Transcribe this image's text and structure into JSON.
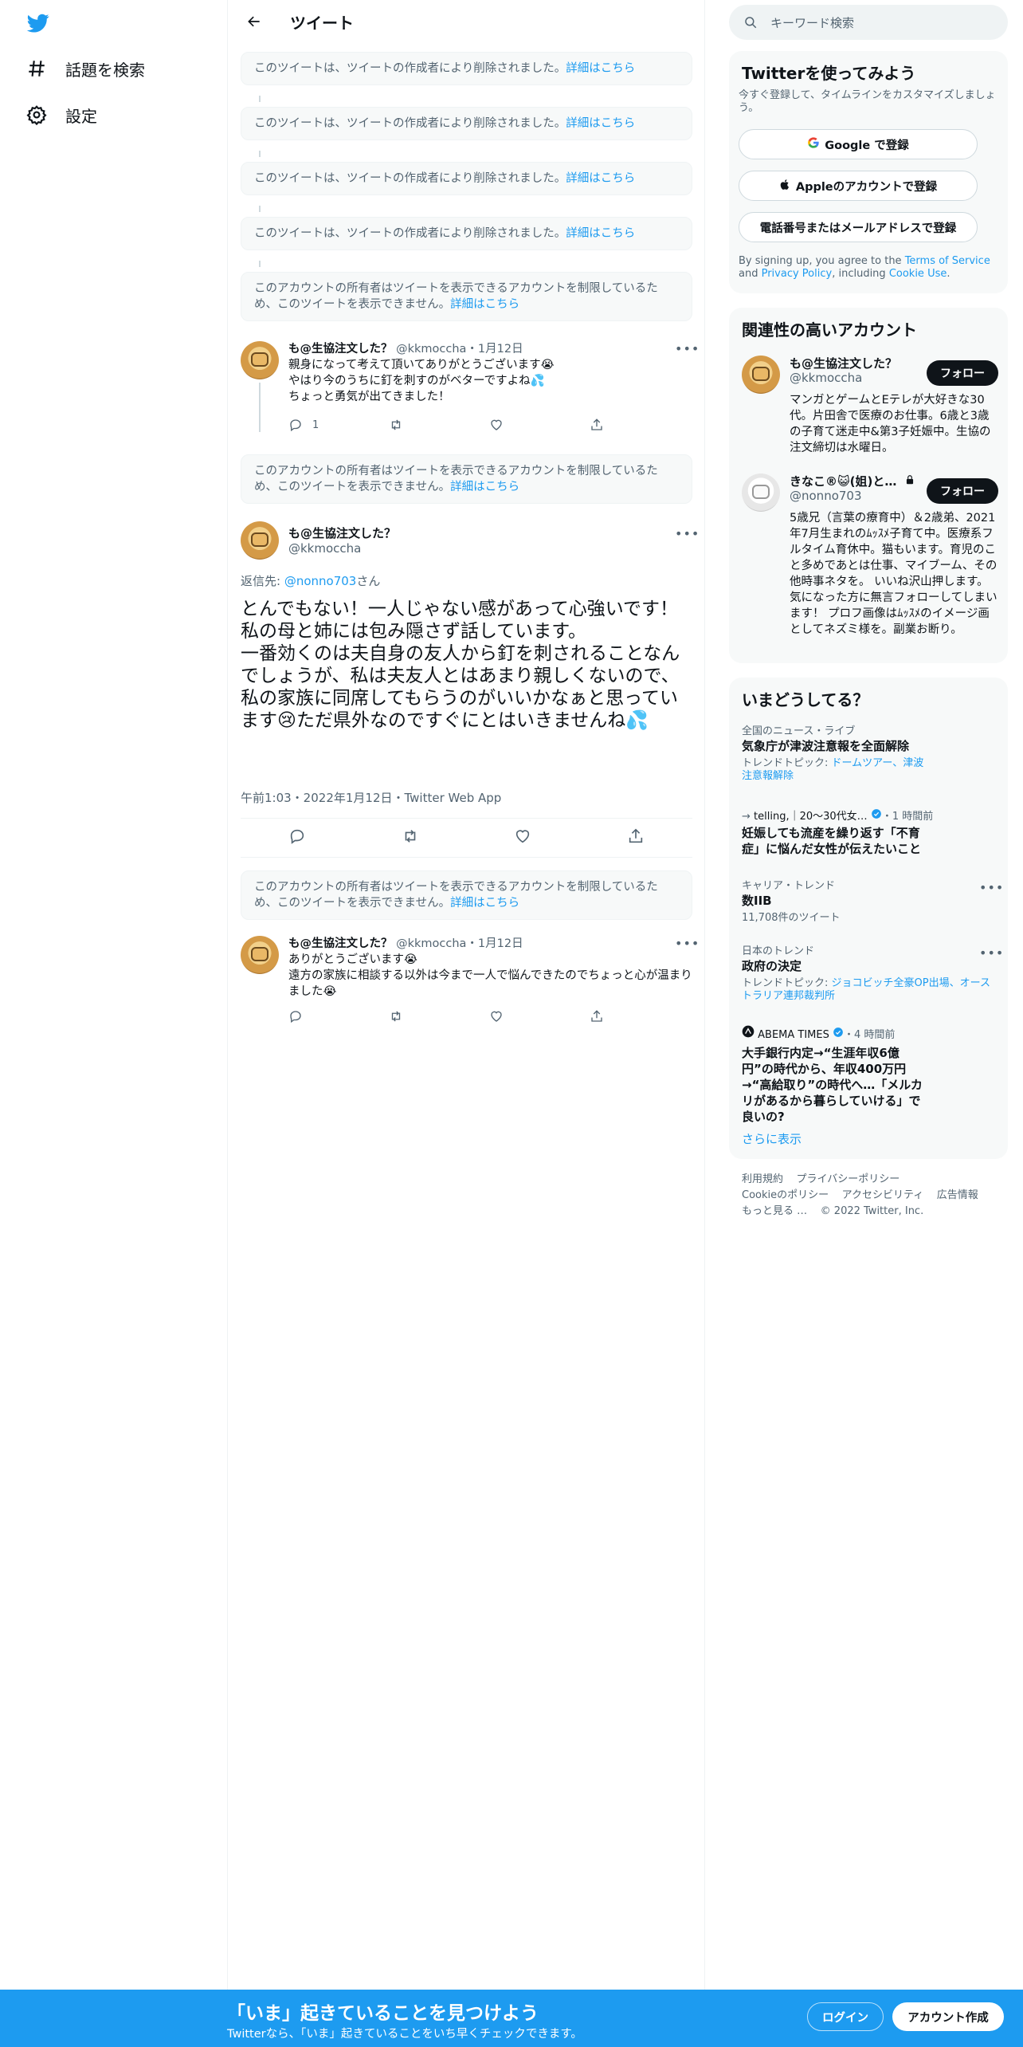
{
  "nav": {
    "explore": "話題を検索",
    "settings": "設定"
  },
  "header": {
    "title": "ツイート"
  },
  "notices": {
    "deleted": "このツイートは、ツイートの作成者により削除されました。",
    "restricted": "このアカウントの所有者はツイートを表示できるアカウントを制限しているため、このツイートを表示できません。",
    "link": "詳細はこちら"
  },
  "tweet1": {
    "name": "も@生協注文した？",
    "handle": "@kkmoccha",
    "date": "1月12日",
    "text": "親身になって考えて頂いてありがとうございます😭\nやはり今のうちに釘を刺すのがベターですよね💦\nちょっと勇気が出てきました！",
    "reply_count": "1"
  },
  "focus": {
    "name": "も@生協注文した？",
    "handle": "@kkmoccha",
    "reply_prefix": "返信先: ",
    "reply_to": "@nonno703",
    "reply_suffix": "さん",
    "text": "とんでもない！一人じゃない感があって心強いです！\n私の母と姉には包み隠さず話しています。\n一番効くのは夫自身の友人から釘を刺されることなんでしょうが、私は夫友人とはあまり親しくないので、私の家族に同席してもらうのがいいかなぁと思っています😢ただ県外なのですぐにとはいきませんね💦",
    "meta": "午前1:03・2022年1月12日・Twitter Web App"
  },
  "tweet2": {
    "name": "も@生協注文した？",
    "handle": "@kkmoccha",
    "date": "1月12日",
    "text": "ありがとうございます😭\n遠方の家族に相談する以外は今まで一人で悩んできたのでちょっと心が温まりました😭"
  },
  "right": {
    "search_placeholder": "キーワード検索",
    "signup": {
      "title": "Twitterを使ってみよう",
      "subtitle": "今すぐ登録して、タイムラインをカスタマイズしましょう。",
      "google": "Google で登録",
      "apple": "Appleのアカウントで登録",
      "phone": "電話番号またはメールアドレスで登録",
      "terms_pre": "By signing up, you agree to the ",
      "terms": "Terms of Service",
      "and": " and ",
      "privacy": "Privacy Policy",
      "including": ", including ",
      "cookie": "Cookie Use",
      "end": "."
    },
    "related": {
      "title": "関連性の高いアカウント",
      "follow": "フォロー",
      "accounts": [
        {
          "name": "も@生協注文した？",
          "handle": "@kkmoccha",
          "bio": "マンガとゲームとEテレが大好きな30代。片田舎で医療のお仕事。6歳と3歳の子育て迷走中&第3子妊娠中。生協の注文締切は水曜日。"
        },
        {
          "name": "きなこ®😺(姐)と…",
          "handle": "@nonno703",
          "bio": "5歳兄（言葉の療育中）＆2歳弟、2021年7月生まれのﾑｯｽﾒ子育て中。医療系フルタイム育休中。猫もいます。育児のこと多めであとは仕事、マイブーム、その他時事ネタを。 いいね沢山押します。気になった方に無言フォローしてしまいます！ プロフ画像はﾑｯｽﾒのイメージ画としてネズミ様を。副業お断り。"
        }
      ]
    },
    "trends": {
      "title": "いまどうしてる？",
      "items": [
        {
          "context": "全国のニュース・ライブ",
          "title": "気象庁が津波注意報を全面解除",
          "topic_label": "トレンドトピック: ",
          "topic": "ドームツアー、津波注意報解除"
        },
        {
          "source": "telling,｜20～30代女…",
          "time": "・1 時間前",
          "title": "妊娠しても流産を繰り返す「不育症」に悩んだ女性が伝えたいこと"
        },
        {
          "context": "キャリア・トレンド",
          "title": "数IIB",
          "count": "11,708件のツイート"
        },
        {
          "context": "日本のトレンド",
          "title": "政府の決定",
          "topic_label": "トレンドトピック: ",
          "topic": "ジョコビッチ全豪OP出場、オーストラリア連邦裁判所"
        },
        {
          "source": "ABEMA TIMES",
          "time": "・4 時間前",
          "title": "大手銀行内定→“生涯年収6億円”の時代から、年収400万円→“高給取り”の時代へ…「メルカリがあるから暮らしていける」で良いの?"
        }
      ],
      "show_more": "さらに表示"
    },
    "footer": {
      "terms": "利用規約",
      "privacy": "プライバシーポリシー",
      "cookie": "Cookieのポリシー",
      "accessibility": "アクセシビリティ",
      "ads": "広告情報",
      "more": "もっと見る …",
      "copyright": "© 2022 Twitter, Inc."
    }
  },
  "bottombar": {
    "headline": "「いま」起きていることを見つけよう",
    "sub": "Twitterなら、「いま」起きていることをいち早くチェックできます。",
    "login": "ログイン",
    "signup": "アカウント作成"
  },
  "colors": {
    "accent": "#1d9bf0",
    "text": "#0f1419",
    "muted": "#536471"
  }
}
